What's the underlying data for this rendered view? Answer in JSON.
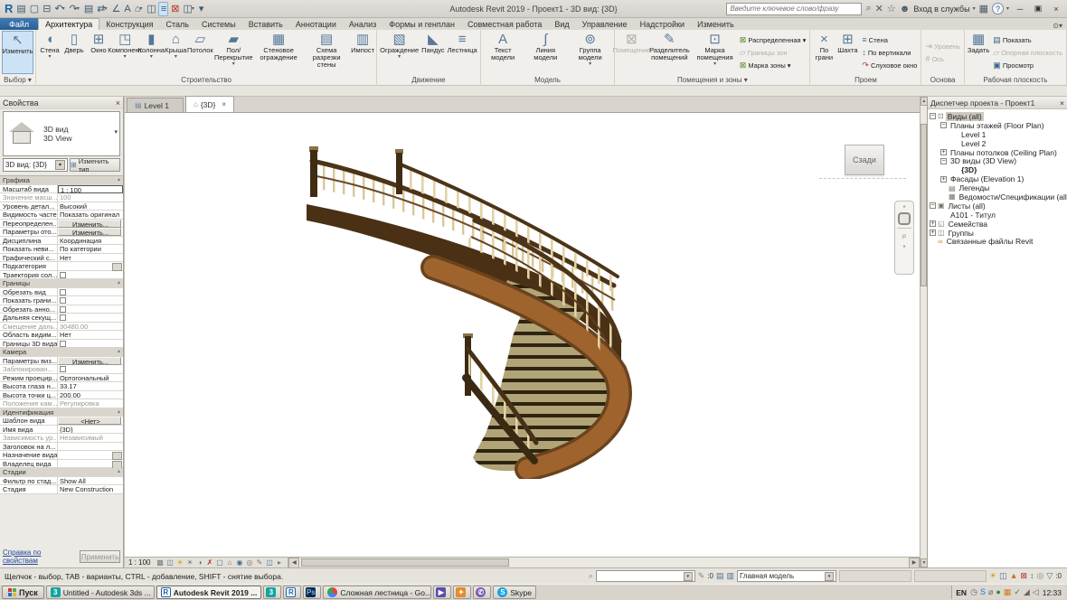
{
  "titlebar": {
    "app_title": "Autodesk Revit 2019 - Проект1 - 3D вид: {3D}",
    "search_placeholder": "Введите ключевое слово/фразу",
    "sign_in": "Вход в службы",
    "qat": [
      {
        "n": "revit-logo",
        "g": "R",
        "c": "logo",
        "arr": ""
      },
      {
        "n": "file-menu-icon",
        "g": "▤",
        "c": "",
        "arr": ""
      },
      {
        "n": "open-icon",
        "g": "▢",
        "c": "",
        "arr": ""
      },
      {
        "n": "save-icon",
        "g": "⊟",
        "c": "",
        "arr": ""
      },
      {
        "n": "undo-icon",
        "g": "↶",
        "c": "",
        "arr": "▾"
      },
      {
        "n": "redo-icon",
        "g": "↷",
        "c": "",
        "arr": "▾"
      },
      {
        "n": "print-icon",
        "g": "▤",
        "c": "",
        "arr": ""
      },
      {
        "n": "sync-icon",
        "g": "⇄",
        "c": "",
        "arr": "▾"
      },
      {
        "n": "measure-icon",
        "g": "∠",
        "c": "",
        "arr": ""
      },
      {
        "n": "text-icon",
        "g": "A",
        "c": "",
        "arr": ""
      },
      {
        "n": "default-3d-view-icon",
        "g": "⌂",
        "c": "",
        "arr": "▾"
      },
      {
        "n": "section-icon",
        "g": "◫",
        "c": "",
        "arr": ""
      },
      {
        "n": "thin-lines-icon",
        "g": "≡",
        "c": "on",
        "arr": ""
      },
      {
        "n": "close-hidden-windows-icon",
        "g": "⊠",
        "c": "rd",
        "arr": ""
      },
      {
        "n": "switch-windows-icon",
        "g": "◫",
        "c": "",
        "arr": "▾"
      },
      {
        "n": "customize-qat-icon",
        "g": "▾",
        "c": "",
        "arr": ""
      }
    ],
    "icons": {
      "binoculars": "⌕",
      "exchange": "✕",
      "star": "☆",
      "person": "☻",
      "cart": "▦",
      "help": "?",
      "min": "─",
      "restore": "▣",
      "close": "×",
      "arrow": "▾"
    }
  },
  "tabs": {
    "file": "Файл",
    "items": [
      {
        "label": "Архитектура",
        "cls": "active"
      },
      {
        "label": "Конструкция",
        "cls": ""
      },
      {
        "label": "Сталь",
        "cls": ""
      },
      {
        "label": "Системы",
        "cls": ""
      },
      {
        "label": "Вставить",
        "cls": ""
      },
      {
        "label": "Аннотации",
        "cls": ""
      },
      {
        "label": "Анализ",
        "cls": ""
      },
      {
        "label": "Формы и генплан",
        "cls": ""
      },
      {
        "label": "Совместная работа",
        "cls": ""
      },
      {
        "label": "Вид",
        "cls": ""
      },
      {
        "label": "Управление",
        "cls": ""
      },
      {
        "label": "Надстройки",
        "cls": ""
      },
      {
        "label": "Изменить",
        "cls": ""
      }
    ],
    "right_icon": "⊙▾"
  },
  "ribbon": {
    "modify": {
      "label": "Изменить",
      "glyph": "↖",
      "panel": "Выбор",
      "panel_arrow": "▾"
    },
    "build": {
      "label": "Строительство",
      "buttons": [
        {
          "label": "Стена",
          "g": "◖",
          "arrow": "▾",
          "cls": ""
        },
        {
          "label": "Дверь",
          "g": "▯",
          "arrow": "",
          "cls": ""
        },
        {
          "label": "Окно",
          "g": "⊞",
          "arrow": "",
          "cls": ""
        },
        {
          "label": "Компонент",
          "g": "◳",
          "arrow": "▾",
          "cls": ""
        },
        {
          "label": "Колонна",
          "g": "▮",
          "arrow": "▾",
          "cls": ""
        },
        {
          "label": "Крыша",
          "g": "⌂",
          "arrow": "▾",
          "cls": ""
        },
        {
          "label": "Потолок",
          "g": "▱",
          "arrow": "",
          "cls": ""
        },
        {
          "label": "Пол/Перекрытие",
          "g": "▰",
          "arrow": "▾",
          "cls": ""
        },
        {
          "label": "Стеновое ограждение",
          "g": "▦",
          "arrow": "",
          "cls": ""
        },
        {
          "label": "Схема разрезки стены",
          "g": "▤",
          "arrow": "",
          "cls": ""
        },
        {
          "label": "Импост",
          "g": "▥",
          "arrow": "",
          "cls": ""
        }
      ]
    },
    "circulation": {
      "label": "Движение",
      "buttons": [
        {
          "label": "Ограждение",
          "g": "▧",
          "arrow": "▾",
          "cls": ""
        },
        {
          "label": "Пандус",
          "g": "◣",
          "arrow": "",
          "cls": ""
        },
        {
          "label": "Лестница",
          "g": "≡",
          "arrow": "",
          "cls": ""
        }
      ]
    },
    "model": {
      "label": "Модель",
      "buttons": [
        {
          "label": "Текст модели",
          "g": "A",
          "arrow": "",
          "cls": ""
        },
        {
          "label": "Линия модели",
          "g": "∫",
          "arrow": "",
          "cls": ""
        },
        {
          "label": "Группа модели",
          "g": "⊚",
          "arrow": "▾",
          "cls": ""
        }
      ]
    },
    "rooms": {
      "label": "Помещения и зоны",
      "panel_arrow": "▾",
      "big": [
        {
          "label": "Помещение",
          "g": "⊠",
          "arrow": "",
          "cls": "dis"
        },
        {
          "label": "Разделитель помещений",
          "g": "✎",
          "arrow": "",
          "cls": ""
        },
        {
          "label": "Марка помещения",
          "g": "⊡",
          "arrow": "▾",
          "cls": ""
        }
      ],
      "small": [
        {
          "label": "Распределенная",
          "g": "⊠",
          "arrow": "▾",
          "cls": "gn"
        },
        {
          "label": "Границы зон",
          "g": "▱",
          "arrow": "",
          "cls": "dis"
        },
        {
          "label": "Марка зоны",
          "g": "⊠",
          "arrow": "▾",
          "cls": "gn"
        }
      ]
    },
    "opening": {
      "label": "Проем",
      "big": [
        {
          "label": "По грани",
          "g": "×",
          "arrow": "",
          "cls": ""
        },
        {
          "label": "Шахта",
          "g": "⊞",
          "arrow": "",
          "cls": ""
        }
      ],
      "small": [
        {
          "label": "Стена",
          "g": "≡",
          "arrow": "",
          "cls": ""
        },
        {
          "label": "По вертикали",
          "g": "↕",
          "arrow": "",
          "cls": ""
        },
        {
          "label": "Слуховое окно",
          "g": "↷",
          "arrow": "",
          "cls": "rd"
        }
      ]
    },
    "datum": {
      "label": "Основа",
      "small": [
        {
          "label": "Уровень",
          "g": "⇥",
          "arrow": "",
          "cls": "dis"
        },
        {
          "label": "Ось",
          "g": "#",
          "arrow": "",
          "cls": "dis"
        }
      ]
    },
    "workplane": {
      "label": "Рабочая плоскость",
      "big": [
        {
          "label": "Задать",
          "g": "▦",
          "arrow": "",
          "cls": ""
        }
      ],
      "small": [
        {
          "label": "Показать",
          "g": "▤",
          "arrow": "",
          "cls": "bl"
        },
        {
          "label": "Опорная плоскость",
          "g": "▱",
          "arrow": "",
          "cls": "dis"
        },
        {
          "label": "Просмотр",
          "g": "▣",
          "arrow": "",
          "cls": "bl"
        }
      ]
    }
  },
  "properties": {
    "header": "Свойства",
    "type_name": "3D вид",
    "type_sub": "3D View",
    "selector": "3D вид: {3D}",
    "edit_type": "Изменить тип",
    "help": "Справка по свойствам",
    "apply": "Применить",
    "rows": [
      {
        "label": "Графика",
        "value": "",
        "cls": "sec"
      },
      {
        "label": "Масштаб вида",
        "value": "1 : 100",
        "cls": "inp"
      },
      {
        "label": "Значение масш...",
        "value": "100",
        "cls": "gray"
      },
      {
        "label": "Уровень детал...",
        "value": "Высокий",
        "cls": ""
      },
      {
        "label": "Видимость частей",
        "value": "Показать оригинал",
        "cls": ""
      },
      {
        "label": "Переопределен...",
        "value": "Изменить...",
        "cls": "btn"
      },
      {
        "label": "Параметры ото...",
        "value": "Изменить...",
        "cls": "btn"
      },
      {
        "label": "Дисциплина",
        "value": "Координация",
        "cls": ""
      },
      {
        "label": "Показать неви...",
        "value": "По категории",
        "cls": ""
      },
      {
        "label": "Графический с...",
        "value": "Нет",
        "cls": ""
      },
      {
        "label": "Подкатегория",
        "value": "",
        "cls": "dots"
      },
      {
        "label": "Траектория сол...",
        "value": "",
        "cls": "chk"
      },
      {
        "label": "Границы",
        "value": "",
        "cls": "sec"
      },
      {
        "label": "Обрезать вид",
        "value": "",
        "cls": "chk"
      },
      {
        "label": "Показать грани...",
        "value": "",
        "cls": "chk"
      },
      {
        "label": "Обрезать анно...",
        "value": "",
        "cls": "chk"
      },
      {
        "label": "Дальняя секущ...",
        "value": "",
        "cls": "chk"
      },
      {
        "label": "Смещение даль...",
        "value": "30480.00",
        "cls": "gray"
      },
      {
        "label": "Область видим...",
        "value": "Нет",
        "cls": ""
      },
      {
        "label": "Границы 3D вида",
        "value": "",
        "cls": "chk"
      },
      {
        "label": "Камера",
        "value": "",
        "cls": "sec"
      },
      {
        "label": "Параметры виз...",
        "value": "Изменить...",
        "cls": "btn"
      },
      {
        "label": "Заблокирован...",
        "value": "",
        "cls": "chk gray"
      },
      {
        "label": "Режим проецир...",
        "value": "Ортогональный",
        "cls": ""
      },
      {
        "label": "Высота глаза н...",
        "value": "33.17",
        "cls": ""
      },
      {
        "label": "Высота точки ц...",
        "value": "200.00",
        "cls": ""
      },
      {
        "label": "Положение кам...",
        "value": "Регулировка",
        "cls": "gray"
      },
      {
        "label": "Идентификация",
        "value": "",
        "cls": "sec"
      },
      {
        "label": "Шаблон вида",
        "value": "<Нет>",
        "cls": "btn"
      },
      {
        "label": "Имя вида",
        "value": "{3D}",
        "cls": ""
      },
      {
        "label": "Зависимость ур...",
        "value": "Независимый",
        "cls": "gray"
      },
      {
        "label": "Заголовок на л...",
        "value": "",
        "cls": ""
      },
      {
        "label": "Назначение вида",
        "value": "",
        "cls": "dots"
      },
      {
        "label": "Владелец вида",
        "value": "",
        "cls": "dots"
      },
      {
        "label": "Стадии",
        "value": "",
        "cls": "sec"
      },
      {
        "label": "Фильтр по стад...",
        "value": "Show All",
        "cls": ""
      },
      {
        "label": "Стадия",
        "value": "New Construction",
        "cls": ""
      }
    ]
  },
  "viewtabs": [
    {
      "label": "Level 1",
      "icon": "▤",
      "cls": "",
      "close": ""
    },
    {
      "label": "{3D}",
      "icon": "⌂",
      "cls": "active",
      "close": "×"
    }
  ],
  "viewcube": {
    "face": "Сзади"
  },
  "viewbar": {
    "scale": "1 : 100",
    "icons": [
      {
        "g": "▩",
        "c": "g"
      },
      {
        "g": "◫",
        "c": "s"
      },
      {
        "g": "☀",
        "c": "y"
      },
      {
        "g": "☀",
        "c": "g"
      },
      {
        "g": "◑",
        "c": "s"
      },
      {
        "g": "✗",
        "c": "r"
      },
      {
        "g": "▢",
        "c": "s"
      },
      {
        "g": "⌂",
        "c": "g"
      },
      {
        "g": "◉",
        "c": "s"
      },
      {
        "g": "◎",
        "c": "g"
      },
      {
        "g": "✎",
        "c": "g"
      },
      {
        "g": "◫",
        "c": "s"
      },
      {
        "g": "▸",
        "c": "g"
      }
    ]
  },
  "browser": {
    "header": "Диспетчер проекта - Проект1",
    "items": [
      {
        "label": "Виды (all)",
        "cls": "d0 sel",
        "glyph": "−",
        "icon": "⊡"
      },
      {
        "label": "Планы этажей (Floor Plan)",
        "cls": "d1",
        "glyph": "−",
        "icon": ""
      },
      {
        "label": "Level 1",
        "cls": "d2",
        "glyph": "",
        "icon": ""
      },
      {
        "label": "Level 2",
        "cls": "d2",
        "glyph": "",
        "icon": ""
      },
      {
        "label": "Планы потолков (Ceiling Plan)",
        "cls": "d1",
        "glyph": "+",
        "icon": ""
      },
      {
        "label": "3D виды (3D View)",
        "cls": "d1",
        "glyph": "−",
        "icon": ""
      },
      {
        "label": "{3D}",
        "cls": "d2 bold",
        "glyph": "",
        "icon": ""
      },
      {
        "label": "Фасады (Elevation 1)",
        "cls": "d1",
        "glyph": "+",
        "icon": ""
      },
      {
        "label": "Легенды",
        "cls": "d1",
        "glyph": "",
        "icon": "▤"
      },
      {
        "label": "Ведомости/Спецификации (all)",
        "cls": "d1",
        "glyph": "",
        "icon": "▦"
      },
      {
        "label": "Листы (all)",
        "cls": "d0",
        "glyph": "−",
        "icon": "▣"
      },
      {
        "label": "A101 - Титул",
        "cls": "d1",
        "glyph": "",
        "icon": ""
      },
      {
        "label": "Семейства",
        "cls": "d0",
        "glyph": "+",
        "icon": "◱"
      },
      {
        "label": "Группы",
        "cls": "d0",
        "glyph": "+",
        "icon": "◫"
      },
      {
        "label": "Связанные файлы Revit",
        "cls": "d0 link",
        "glyph": "",
        "icon": "∞"
      }
    ]
  },
  "statusbar": {
    "hint": "Щелчок - выбор, TAB - варианты, CTRL - добавление, SHIFT - снятие выбора.",
    "edit_count": ":0",
    "main_model": "Главная модель",
    "filter_count": ":0",
    "icons": [
      {
        "g": "☀",
        "c": "y"
      },
      {
        "g": "◫",
        "c": "s"
      },
      {
        "g": "▲",
        "c": "o"
      },
      {
        "g": "⊠",
        "c": "r"
      },
      {
        "g": "↕",
        "c": "s"
      },
      {
        "g": "◎",
        "c": "g"
      },
      {
        "g": "▽",
        "c": "s"
      }
    ]
  },
  "taskbar": {
    "start": "Пуск",
    "buttons": [
      {
        "label": "Untitled - Autodesk 3ds ...",
        "icon": "3",
        "iconcls": "ic3",
        "cls": ""
      },
      {
        "label": "Autodesk Revit 2019 ...",
        "icon": "R",
        "iconcls": "icR",
        "cls": "active"
      },
      {
        "label": "",
        "icon": "3",
        "iconcls": "ic3",
        "cls": "iconly"
      },
      {
        "label": "",
        "icon": "R",
        "iconcls": "icR",
        "cls": "iconly"
      },
      {
        "label": "",
        "icon": "Ps",
        "iconcls": "icPs",
        "cls": "iconly"
      },
      {
        "label": "Сложная лестница - Go...",
        "icon": "",
        "iconcls": "icChrome",
        "cls": ""
      },
      {
        "label": "",
        "icon": "▶",
        "iconcls": "icPurple",
        "cls": "iconly"
      },
      {
        "label": "",
        "icon": "✦",
        "iconcls": "icOrange",
        "cls": "iconly"
      },
      {
        "label": "",
        "icon": "✆",
        "iconcls": "icViber",
        "cls": "iconly"
      },
      {
        "label": "Skype",
        "icon": "S",
        "iconcls": "icSkype",
        "cls": ""
      }
    ],
    "tray": {
      "lang": "EN",
      "time": "12:33",
      "icons": [
        {
          "g": "◷",
          "c": "g"
        },
        {
          "g": "S",
          "c": "bl"
        },
        {
          "g": "⌀",
          "c": "g"
        },
        {
          "g": "●",
          "c": "gn"
        },
        {
          "g": "▦",
          "c": "or"
        },
        {
          "g": "✓",
          "c": "gn"
        },
        {
          "g": "◢",
          "c": "g"
        },
        {
          "g": "◁",
          "c": "g"
        }
      ]
    }
  }
}
